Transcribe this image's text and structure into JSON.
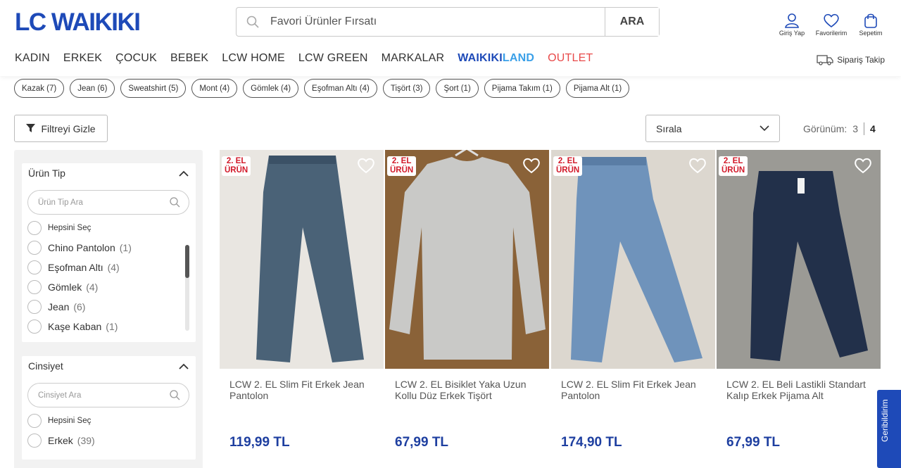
{
  "header": {
    "logo": "LC WAIKIKI",
    "search": {
      "placeholder": "Favori Ürünler Fırsatı",
      "button": "ARA"
    },
    "actions": [
      {
        "label": "Giriş Yap",
        "icon": "user-icon"
      },
      {
        "label": "Favorilerim",
        "icon": "heart-icon"
      },
      {
        "label": "Sepetim",
        "icon": "bag-icon"
      }
    ],
    "nav": [
      "KADIN",
      "ERKEK",
      "ÇOCUK",
      "BEBEK",
      "LCW HOME",
      "LCW GREEN",
      "MARKALAR"
    ],
    "nav_waikiki_1": "WAIKIKI",
    "nav_waikiki_2": "LAND",
    "nav_outlet": "OUTLET",
    "order_tracking": "Sipariş Takip"
  },
  "chips": [
    "Kazak (7)",
    "Jean (6)",
    "Sweatshirt (5)",
    "Mont (4)",
    "Gömlek (4)",
    "Eşofman Altı (4)",
    "Tişört (3)",
    "Şort (1)",
    "Pijama Takım (1)",
    "Pijama Alt (1)"
  ],
  "toolbar": {
    "filter_label": "Filtreyi Gizle",
    "sort_label": "Sırala",
    "view_label": "Görünüm:",
    "view_3": "3",
    "view_4": "4"
  },
  "sidebar": {
    "urun_tip": {
      "title": "Ürün Tip",
      "search_placeholder": "Ürün Tip Ara",
      "select_all": "Hepsini Seç",
      "options": [
        {
          "label": "Chino Pantolon",
          "count": "(1)"
        },
        {
          "label": "Eşofman Altı",
          "count": "(4)"
        },
        {
          "label": "Gömlek",
          "count": "(4)"
        },
        {
          "label": "Jean",
          "count": "(6)"
        },
        {
          "label": "Kaşe Kaban",
          "count": "(1)"
        }
      ]
    },
    "cinsiyet": {
      "title": "Cinsiyet",
      "search_placeholder": "Cinsiyet Ara",
      "select_all": "Hepsini Seç",
      "options": [
        {
          "label": "Erkek",
          "count": "(39)"
        }
      ]
    }
  },
  "badge": {
    "line1": "2. EL",
    "line2": "ÜRÜN"
  },
  "products": [
    {
      "name": "LCW 2. EL Slim Fit Erkek Jean Pantolon",
      "price": "119,99 TL",
      "colors": {
        "bg": "#e9e6e1",
        "item": "#4a6277"
      }
    },
    {
      "name": "LCW 2. EL Bisiklet Yaka Uzun Kollu Düz Erkek Tişört",
      "price": "67,99 TL",
      "colors": {
        "bg": "#8a6238",
        "item": "#c9c9c7"
      }
    },
    {
      "name": "LCW 2. EL Slim Fit Erkek Jean Pantolon",
      "price": "174,90 TL",
      "colors": {
        "bg": "#dcd7cf",
        "item": "#6f93bb"
      }
    },
    {
      "name": "LCW 2. EL Beli Lastikli Standart Kalıp Erkek Pijama Alt",
      "price": "67,99 TL",
      "colors": {
        "bg": "#9b9a95",
        "item": "#22304a"
      }
    }
  ],
  "feedback_tab": "Geribildirim"
}
